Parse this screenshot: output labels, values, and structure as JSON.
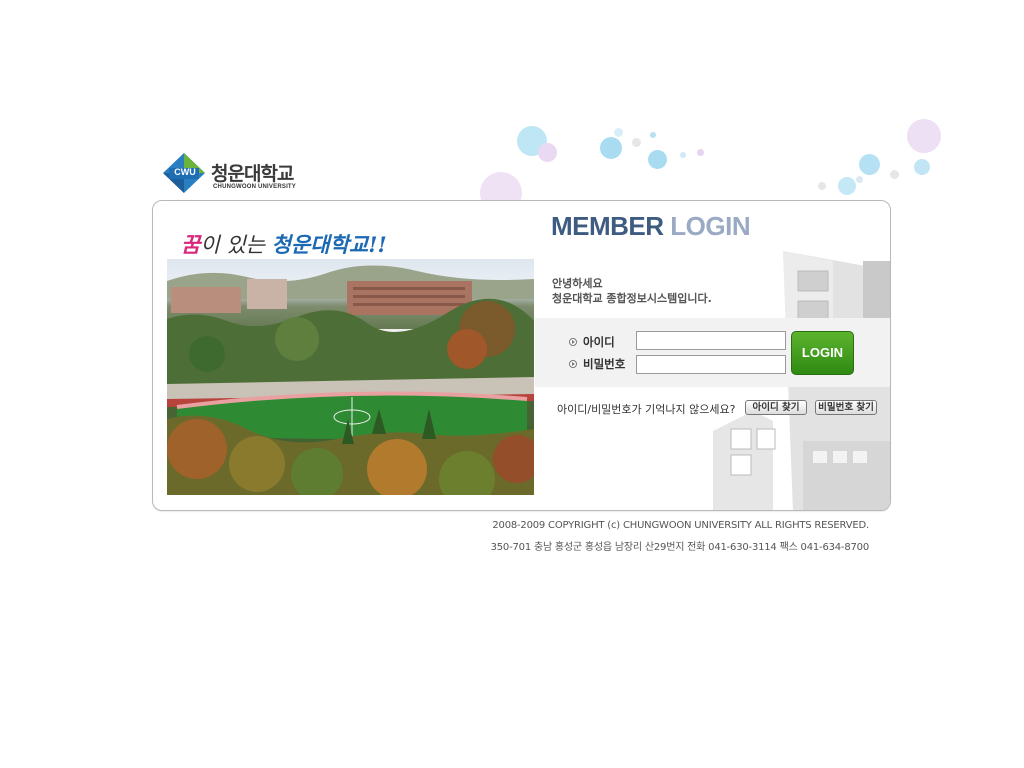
{
  "logo": {
    "mark": "CWU",
    "name": "청운대학교",
    "subname": "CHUNGWOON UNIVERSITY"
  },
  "slogan": {
    "part1": "꿈",
    "part2": "이 있는 ",
    "part3": "청운대학교!!"
  },
  "login": {
    "title_a": "MEMBER",
    "title_b": "LOGIN",
    "greeting_line1": "안녕하세요",
    "greeting_line2": "청운대학교 종합정보시스템입니다.",
    "id_label": "아이디",
    "pw_label": "비밀번호",
    "id_value": "",
    "pw_value": "",
    "login_button": "LOGIN",
    "forgot_text": "아이디/비밀번호가 기억나지 않으세요?",
    "find_id_button": "아이디 찾기",
    "find_pw_button": "비밀번호 찾기"
  },
  "footer": {
    "copyright": "2008-2009 COPYRIGHT (c) CHUNGWOON UNIVERSITY ALL RIGHTS RESERVED.",
    "address": "350-701 충남 홍성군 홍성읍 남장리 산29번지 전화 041-630-3114   팩스 041-634-8700"
  },
  "colors": {
    "accent_green": "#3a9a1a",
    "title_dark": "#3e5c82",
    "title_light": "#9aa9c4",
    "slogan_pink": "#d7287a",
    "slogan_blue": "#1b68b3"
  },
  "icons": {
    "logo_mark": "diamond-logo-icon",
    "bullet": "circle-arrow-bullet-icon"
  }
}
